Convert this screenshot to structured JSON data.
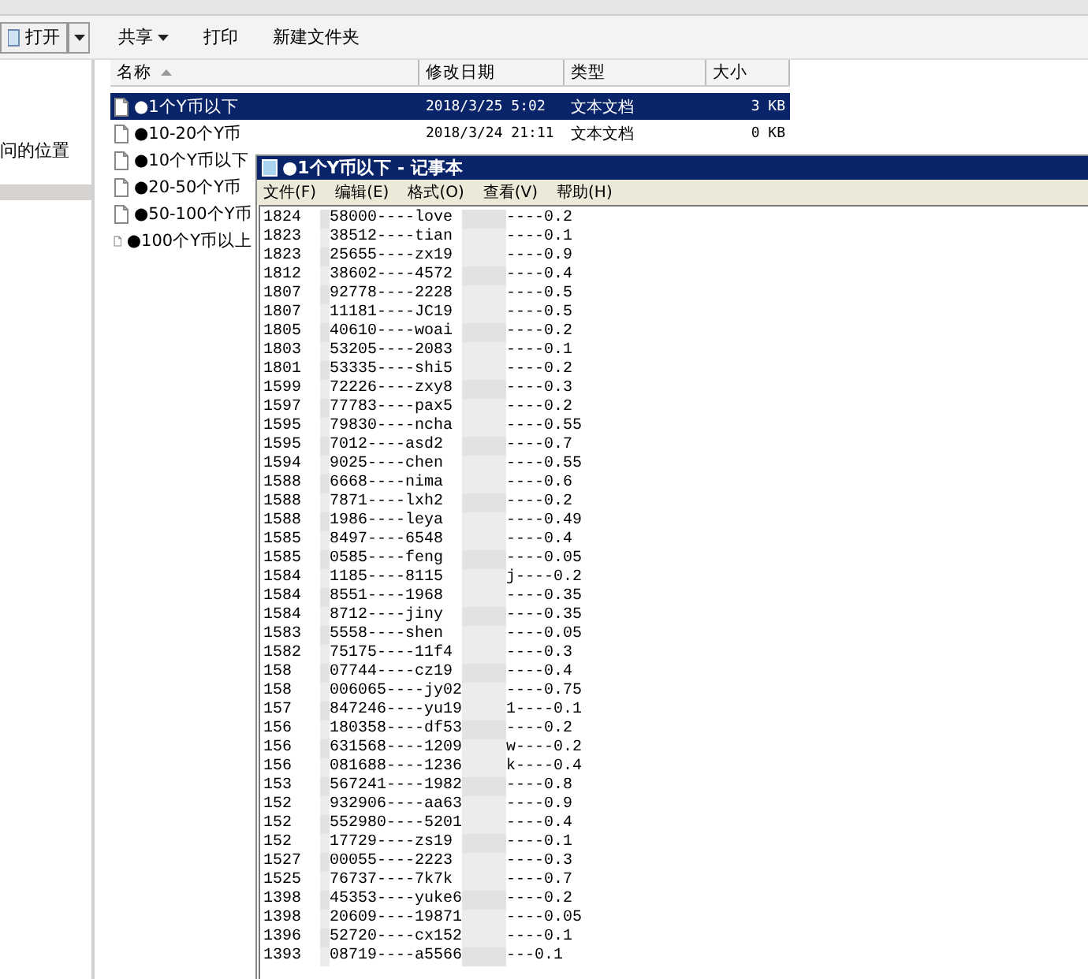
{
  "toolbar": {
    "buttons": [
      {
        "label": "打开",
        "kind": "split"
      },
      {
        "label": "共享",
        "kind": "menu"
      },
      {
        "label": "打印",
        "kind": "plain"
      },
      {
        "label": "新建文件夹",
        "kind": "plain"
      }
    ]
  },
  "nav_pane": {
    "items": [
      {
        "label": "问的位置",
        "selected": false
      }
    ]
  },
  "file_list": {
    "columns": [
      {
        "label": "名称",
        "sorted": true
      },
      {
        "label": "修改日期",
        "sorted": false
      },
      {
        "label": "类型",
        "sorted": false
      },
      {
        "label": "大小",
        "sorted": false
      }
    ],
    "rows": [
      {
        "name": "●1个Y币以下",
        "date": "2018/3/25 5:02",
        "type": "文本文档",
        "size": "3 KB",
        "selected": true
      },
      {
        "name": "●10-20个Y币",
        "date": "2018/3/24 21:11",
        "type": "文本文档",
        "size": "0 KB",
        "selected": false
      },
      {
        "name": "●10个Y币以下",
        "selected": false
      },
      {
        "name": "●20-50个Y币",
        "selected": false
      },
      {
        "name": "●50-100个Y币",
        "selected": false
      },
      {
        "name": "●100个Y币以上",
        "selected": false
      }
    ]
  },
  "notepad": {
    "title": "●1个Y币以下 - 记事本",
    "menu": [
      "文件(F)",
      "编辑(E)",
      "格式(O)",
      "查看(V)",
      "帮助(H)"
    ],
    "lines": [
      [
        "1824",
        "58000----love",
        "----0.2"
      ],
      [
        "1823",
        "38512----tian",
        "----0.1"
      ],
      [
        "1823",
        "25655----zx19",
        "----0.9"
      ],
      [
        "1812",
        "38602----4572",
        "----0.4"
      ],
      [
        "1807",
        "92778----2228",
        "----0.5"
      ],
      [
        "1807",
        "11181----JC19",
        "----0.5"
      ],
      [
        "1805",
        "40610----woai",
        "----0.2"
      ],
      [
        "1803",
        "53205----2083",
        "----0.1"
      ],
      [
        "1801",
        "53335----shi5",
        "----0.2"
      ],
      [
        "1599",
        "72226----zxy8",
        "----0.3"
      ],
      [
        "1597",
        "77783----pax5",
        "----0.2"
      ],
      [
        "1595",
        "79830----ncha",
        "----0.55"
      ],
      [
        "1595",
        "7012----asd2",
        "----0.7"
      ],
      [
        "1594",
        "9025----chen",
        "----0.55"
      ],
      [
        "1588",
        "6668----nima",
        "----0.6"
      ],
      [
        "1588",
        "7871----lxh2",
        "----0.2"
      ],
      [
        "1588",
        "1986----leya",
        "----0.49"
      ],
      [
        "1585",
        "8497----6548",
        "----0.4"
      ],
      [
        "1585",
        "0585----feng",
        "----0.05"
      ],
      [
        "1584",
        "1185----8115",
        "j----0.2"
      ],
      [
        "1584",
        "8551----1968",
        "----0.35"
      ],
      [
        "1584",
        "8712----jiny",
        "----0.35"
      ],
      [
        "1583",
        "5558----shen",
        "----0.05"
      ],
      [
        "1582",
        "75175----11f4",
        "----0.3"
      ],
      [
        "158",
        "07744----cz19",
        "----0.4"
      ],
      [
        "158",
        "006065----jy02",
        "----0.75"
      ],
      [
        "157",
        "847246----yu19",
        "1----0.1"
      ],
      [
        "156",
        "180358----df53",
        "----0.2"
      ],
      [
        "156",
        "631568----1209",
        "w----0.2"
      ],
      [
        "156",
        "081688----1236",
        "k----0.4"
      ],
      [
        "153",
        "567241----1982",
        "----0.8"
      ],
      [
        "152",
        "932906----aa63",
        "----0.9"
      ],
      [
        "152",
        "552980----5201",
        "----0.4"
      ],
      [
        "152",
        "17729----zs19",
        "----0.1"
      ],
      [
        "1527",
        "00055----2223",
        "----0.3"
      ],
      [
        "1525",
        "76737----7k7k",
        "----0.7"
      ],
      [
        "1398",
        "45353----yuke6",
        "----0.2"
      ],
      [
        "1398",
        "20609----19871",
        "----0.05"
      ],
      [
        "1396",
        "52720----cx152",
        "----0.1"
      ],
      [
        "1393",
        "08719----a5566",
        "---0.1"
      ]
    ]
  }
}
